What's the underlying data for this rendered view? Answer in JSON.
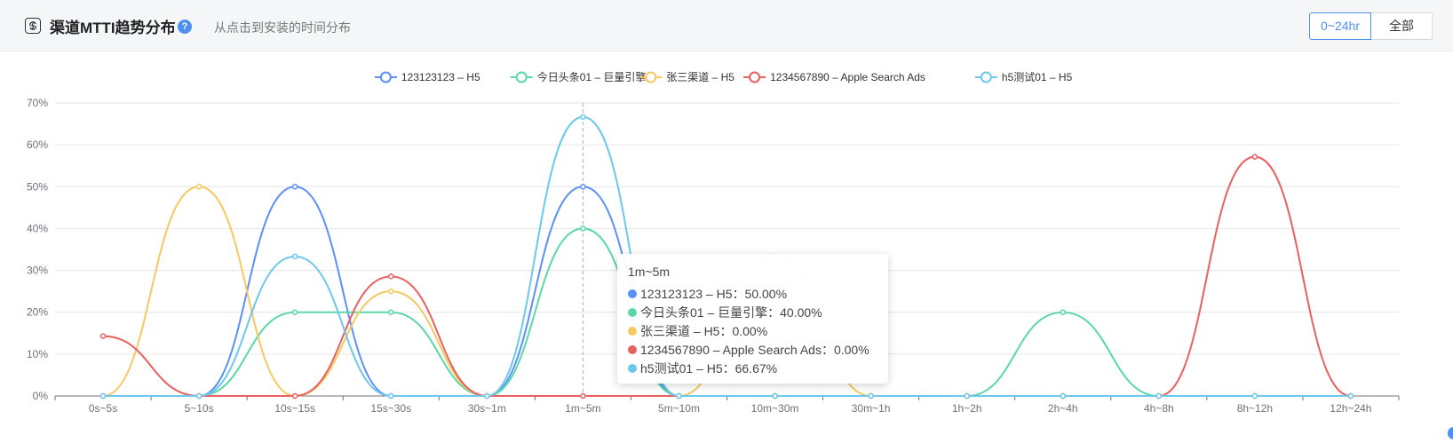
{
  "header": {
    "title": "渠道MTTI趋势分布",
    "help_icon": "question-circle-icon",
    "subtitle": "从点击到安装的时间分布",
    "range_buttons": [
      "0~24hr",
      "全部"
    ],
    "active_range": "0~24hr"
  },
  "colors": {
    "accent": "#4e8ff0",
    "grid": "#e6e6e6",
    "axis": "#6e7079"
  },
  "chart_data": {
    "type": "line",
    "smooth": true,
    "title": "",
    "xlabel": "",
    "ylabel": "",
    "ylim": [
      0,
      70
    ],
    "yticks": [
      "0%",
      "10%",
      "20%",
      "30%",
      "40%",
      "50%",
      "60%",
      "70%"
    ],
    "grid": true,
    "legend_position": "top-center",
    "categories": [
      "0s~5s",
      "5~10s",
      "10s~15s",
      "15s~30s",
      "30s~1m",
      "1m~5m",
      "5m~10m",
      "10m~30m",
      "30m~1h",
      "1h~2h",
      "2h~4h",
      "4h~8h",
      "8h~12h",
      "12h~24h"
    ],
    "series": [
      {
        "name": "123123123 – H5",
        "color": "#5b8ff9",
        "values": [
          0,
          0,
          50,
          0,
          0,
          50,
          0,
          0,
          0,
          0,
          0,
          0,
          0,
          0
        ]
      },
      {
        "name": "今日头条01 – 巨量引擎",
        "color": "#5ad8a6",
        "values": [
          0,
          0,
          20,
          20,
          0,
          40,
          0,
          0,
          0,
          0,
          20,
          0,
          0,
          0
        ]
      },
      {
        "name": "张三渠道 – H5",
        "color": "#f6c85f",
        "values": [
          0,
          50,
          0,
          25,
          0,
          0,
          0,
          33.33,
          0,
          0,
          0,
          0,
          0,
          0
        ]
      },
      {
        "name": "1234567890 – Apple Search Ads",
        "color": "#e8615f",
        "values": [
          14.29,
          0,
          0,
          28.57,
          0,
          0,
          0,
          0,
          0,
          0,
          0,
          0,
          57.14,
          0
        ]
      },
      {
        "name": "h5测试01 – H5",
        "color": "#6dc8ec",
        "values": [
          0,
          0,
          33.33,
          0,
          0,
          66.67,
          0,
          0,
          0,
          0,
          0,
          0,
          0,
          0
        ]
      }
    ],
    "tooltip": {
      "category": "1m~5m",
      "rows": [
        "123123123 – H5：50.00%",
        "今日头条01 – 巨量引擎：40.00%",
        "张三渠道 – H5：0.00%",
        "1234567890 – Apple Search Ads：0.00%",
        "h5测试01 – H5：66.67%"
      ]
    }
  }
}
